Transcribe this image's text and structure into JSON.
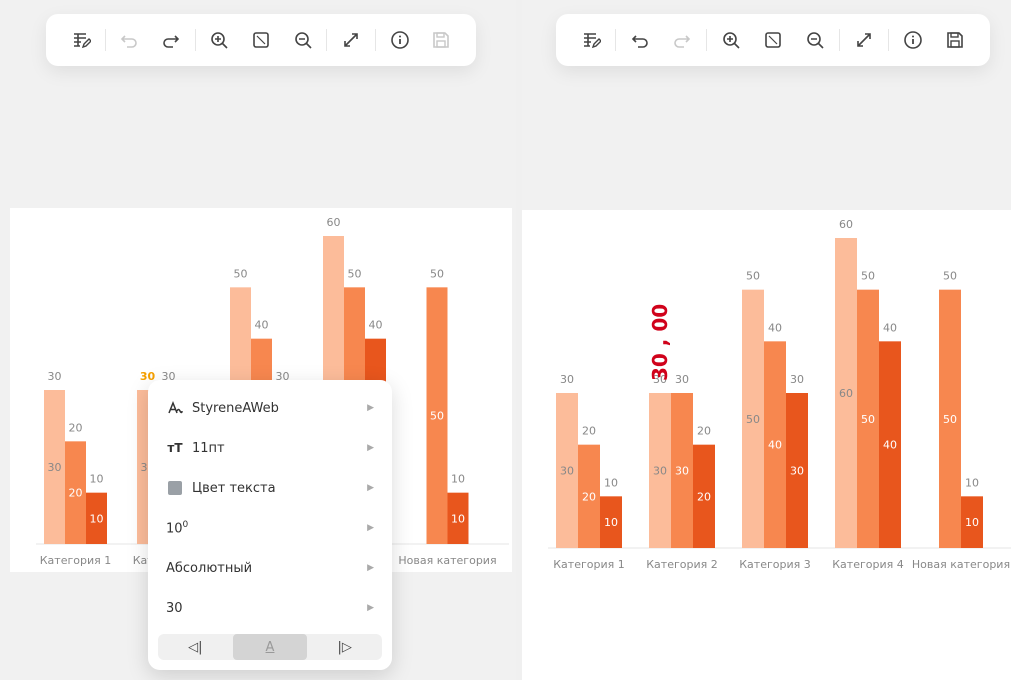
{
  "toolbar_left": {
    "buttons": [
      {
        "name": "table-edit-icon",
        "enabled": true
      },
      {
        "name": "undo-icon",
        "enabled": false
      },
      {
        "name": "redo-icon",
        "enabled": true
      },
      {
        "name": "zoom-in-icon",
        "enabled": true
      },
      {
        "name": "fit-icon",
        "enabled": true
      },
      {
        "name": "zoom-out-icon",
        "enabled": true
      },
      {
        "name": "expand-icon",
        "enabled": true
      },
      {
        "name": "info-icon",
        "enabled": true
      },
      {
        "name": "save-icon",
        "enabled": false
      }
    ]
  },
  "toolbar_right": {
    "buttons": [
      {
        "name": "table-edit-icon",
        "enabled": true
      },
      {
        "name": "undo-icon",
        "enabled": true
      },
      {
        "name": "redo-icon",
        "enabled": false
      },
      {
        "name": "zoom-in-icon",
        "enabled": true
      },
      {
        "name": "fit-icon",
        "enabled": true
      },
      {
        "name": "zoom-out-icon",
        "enabled": true
      },
      {
        "name": "expand-icon",
        "enabled": true
      },
      {
        "name": "info-icon",
        "enabled": true
      },
      {
        "name": "save-icon",
        "enabled": true
      }
    ]
  },
  "context_menu": {
    "font": "StyreneAWeb",
    "size": "11пт",
    "text_color": "Цвет текста",
    "power": "10",
    "power_exp": "0",
    "mode": "Абсолютный",
    "value": "30",
    "align_left": "◁|",
    "align_center": "A",
    "align_right": "|▷"
  },
  "colors": {
    "series1": "#fcbc9a",
    "series2": "#f7874f",
    "series3": "#e8561d",
    "highlight_red": "#d0021b",
    "highlight_yellow": "#f5a000"
  },
  "chart_data": [
    {
      "type": "bar",
      "categories": [
        "Категория 1",
        "Категория 2",
        "Категория 3",
        "Категория 4",
        "Новая категория"
      ],
      "series": [
        {
          "values": [
            30,
            30,
            50,
            60,
            null
          ]
        },
        {
          "values": [
            20,
            30,
            40,
            50,
            50
          ]
        },
        {
          "values": [
            10,
            20,
            30,
            40,
            10
          ]
        }
      ],
      "ylim": [
        0,
        60
      ]
    },
    {
      "type": "bar",
      "categories": [
        "Категория 1",
        "Категория 2",
        "Категория 3",
        "Категория 4",
        "Новая категория"
      ],
      "series": [
        {
          "values": [
            30,
            30,
            50,
            60,
            null
          ]
        },
        {
          "values": [
            20,
            30,
            40,
            50,
            50
          ]
        },
        {
          "values": [
            10,
            20,
            30,
            40,
            10
          ]
        }
      ],
      "ylim": [
        0,
        60
      ],
      "annotation": "30 , 00"
    }
  ]
}
